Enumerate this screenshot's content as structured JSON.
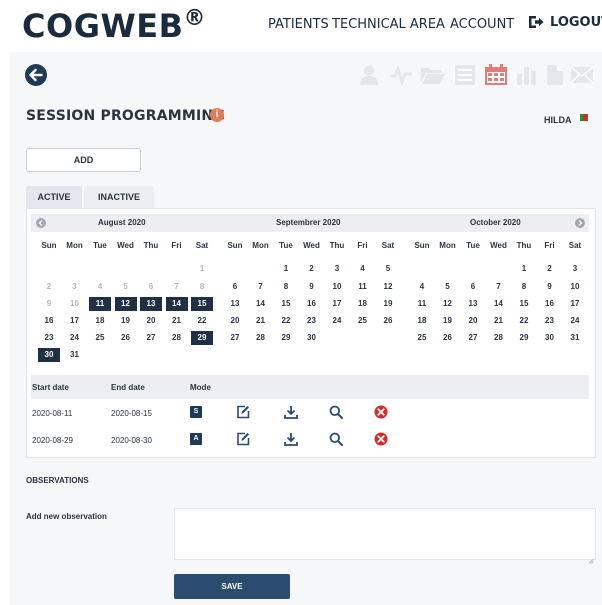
{
  "header": {
    "logo": "COGWEB",
    "logo_mark": "®",
    "nav": {
      "patients": "PATIENTS",
      "technical_area": "TECHNICAL AREA",
      "account": "ACCOUNT",
      "logout": "LOGOUT"
    }
  },
  "toolbar": {
    "icons": [
      "user-icon",
      "pulse-icon",
      "folder-icon",
      "list-icon",
      "calendar-icon",
      "bar-chart-icon",
      "document-icon",
      "mail-icon"
    ],
    "active_icon": "calendar-icon",
    "active_color": "#e27b7b",
    "inactive_color": "#e4e6e9"
  },
  "page": {
    "title": "SESSION PROGRAMMING",
    "info_icon": "i",
    "patient_name": "HILDA",
    "add_label": "ADD"
  },
  "tabs": [
    {
      "label": "ACTIVE",
      "active": true
    },
    {
      "label": "INACTIVE",
      "active": false
    }
  ],
  "calendar": {
    "days_of_week": [
      "Sun",
      "Mon",
      "Tue",
      "Wed",
      "Thu",
      "Fri",
      "Sat"
    ],
    "months": [
      {
        "title": "August 2020",
        "weeks": [
          [
            "",
            "",
            "",
            "",
            "",
            "",
            "1"
          ],
          [
            "2",
            "3",
            "4",
            "5",
            "6",
            "7",
            "8"
          ],
          [
            "9",
            "10",
            "11",
            "12",
            "13",
            "14",
            "15"
          ],
          [
            "16",
            "17",
            "18",
            "19",
            "20",
            "21",
            "22"
          ],
          [
            "23",
            "24",
            "25",
            "26",
            "27",
            "28",
            "29"
          ],
          [
            "30",
            "31",
            "",
            "",
            "",
            "",
            ""
          ]
        ],
        "muted": [
          "1",
          "2",
          "3",
          "4",
          "5",
          "6",
          "7",
          "8",
          "9",
          "10"
        ],
        "selected": [
          "11",
          "12",
          "13",
          "14",
          "15",
          "29",
          "30"
        ]
      },
      {
        "title": "Septembrer 2020",
        "weeks": [
          [
            "",
            "",
            "1",
            "2",
            "3",
            "4",
            "5"
          ],
          [
            "6",
            "7",
            "8",
            "9",
            "10",
            "11",
            "12"
          ],
          [
            "13",
            "14",
            "15",
            "16",
            "17",
            "18",
            "19"
          ],
          [
            "20",
            "21",
            "22",
            "23",
            "24",
            "25",
            "26"
          ],
          [
            "27",
            "28",
            "29",
            "30",
            "",
            "",
            ""
          ]
        ],
        "muted": [],
        "selected": []
      },
      {
        "title": "October 2020",
        "weeks": [
          [
            "",
            "",
            "",
            "",
            "1",
            "2",
            "3"
          ],
          [
            "4",
            "5",
            "6",
            "7",
            "8",
            "9",
            "10"
          ],
          [
            "11",
            "12",
            "13",
            "14",
            "15",
            "16",
            "17"
          ],
          [
            "18",
            "19",
            "20",
            "21",
            "22",
            "23",
            "24"
          ],
          [
            "25",
            "26",
            "27",
            "28",
            "29",
            "30",
            "31"
          ]
        ],
        "muted": [],
        "selected": []
      }
    ]
  },
  "sessions": {
    "columns": {
      "start": "Start date",
      "end": "End date",
      "mode": "Mode"
    },
    "rows": [
      {
        "start": "2020-08-11",
        "end": "2020-08-15",
        "mode": "S"
      },
      {
        "start": "2020-08-29",
        "end": "2020-08-30",
        "mode": "A"
      }
    ],
    "action_icons": [
      "edit-icon",
      "download-icon",
      "search-icon",
      "delete-icon"
    ]
  },
  "observations": {
    "title": "OBSERVATIONS",
    "add_label": "Add new observation",
    "value": "",
    "save_label": "SAVE"
  },
  "colors": {
    "brand_dark": "#1b2b3e",
    "selected_day": "#1f2f44",
    "save_button": "#2c4b70",
    "delete": "#d42a2a",
    "info": "#e27b5a"
  }
}
